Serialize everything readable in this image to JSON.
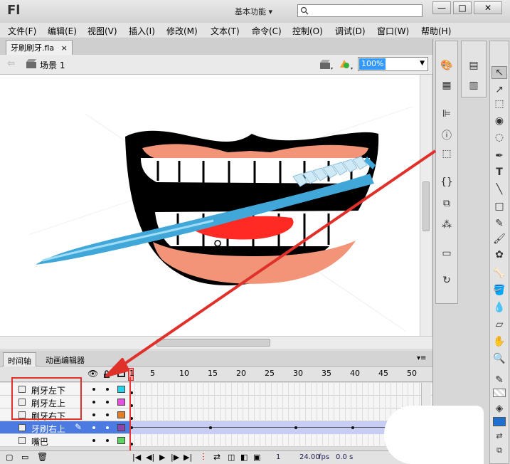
{
  "app": {
    "logo": "Fl",
    "workspace": "基本功能",
    "workspace_arrow": "▾"
  },
  "window": {
    "minimize": "—",
    "maximize": "□",
    "close": "✕"
  },
  "menu": [
    "文件(F)",
    "编辑(E)",
    "视图(V)",
    "插入(I)",
    "修改(M)",
    "文本(T)",
    "命令(C)",
    "控制(O)",
    "调试(D)",
    "窗口(W)",
    "帮助(H)"
  ],
  "document": {
    "tab_label": "牙刷刷牙.fla",
    "tab_close": "×",
    "scene": "场景 1",
    "zoom": "100%"
  },
  "panel_tabs": [
    "时间轴",
    "动画编辑器"
  ],
  "timeline": {
    "frame_numbers": [
      "1",
      "5",
      "10",
      "15",
      "20",
      "25",
      "30",
      "35",
      "40",
      "45",
      "50"
    ],
    "layers": [
      {
        "name": "刷牙左下",
        "color": "#27d3e6",
        "selected": false
      },
      {
        "name": "刷牙左上",
        "color": "#e64de0",
        "selected": false
      },
      {
        "name": "刷牙右下",
        "color": "#e67e22",
        "selected": false
      },
      {
        "name": "牙刷右上",
        "color": "#8e44ad",
        "selected": true
      },
      {
        "name": "嘴巴",
        "color": "#5fd35f",
        "selected": false
      }
    ],
    "current_frame": "1",
    "fps": "24.00",
    "fps_unit": "fps",
    "time": "0.0 s"
  },
  "colors": {
    "highlight": "#e0302a",
    "selection": "#4b7ae0",
    "fill_swatch": "#1f6fd1"
  }
}
